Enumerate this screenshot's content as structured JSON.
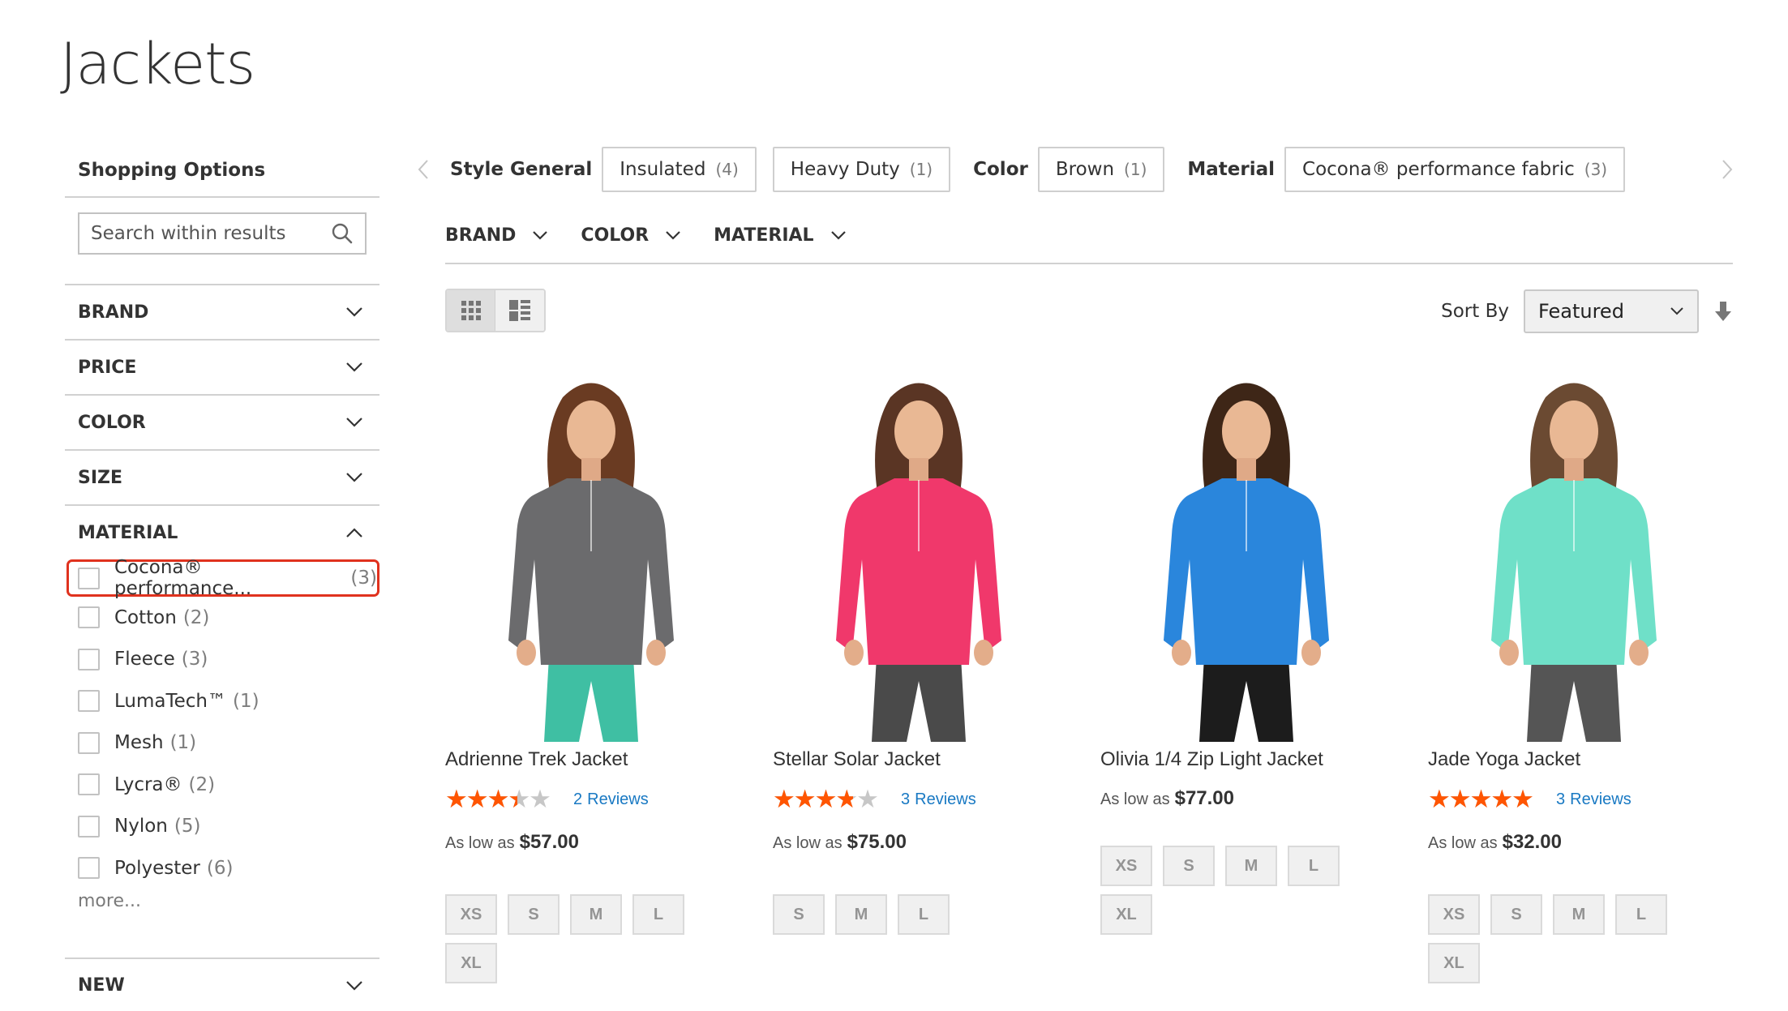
{
  "page": {
    "title": "Jackets"
  },
  "sidebar": {
    "title": "Shopping Options",
    "search_placeholder": "Search within results",
    "filters": [
      {
        "label": "BRAND",
        "expanded": false
      },
      {
        "label": "PRICE",
        "expanded": false
      },
      {
        "label": "COLOR",
        "expanded": false
      },
      {
        "label": "SIZE",
        "expanded": false
      },
      {
        "label": "MATERIAL",
        "expanded": true
      }
    ],
    "material_options": [
      {
        "label": "Cocona® performance...",
        "count": "(3)",
        "checked": false,
        "highlighted": true
      },
      {
        "label": "Cotton",
        "count": "(2)",
        "checked": false
      },
      {
        "label": "Fleece",
        "count": "(3)",
        "checked": false
      },
      {
        "label": "LumaTech™",
        "count": "(1)",
        "checked": false
      },
      {
        "label": "Mesh",
        "count": "(1)",
        "checked": false
      },
      {
        "label": "Lycra®",
        "count": "(2)",
        "checked": false
      },
      {
        "label": "Nylon",
        "count": "(5)",
        "checked": false
      },
      {
        "label": "Polyester",
        "count": "(6)",
        "checked": false
      }
    ],
    "more_label": "more...",
    "new_filter_label": "NEW"
  },
  "chips": {
    "groups": [
      {
        "label": "Style General",
        "items": [
          {
            "label": "Insulated",
            "count": "(4)"
          },
          {
            "label": "Heavy Duty",
            "count": "(1)"
          }
        ]
      },
      {
        "label": "Color",
        "items": [
          {
            "label": "Brown",
            "count": "(1)"
          }
        ]
      },
      {
        "label": "Material",
        "items": [
          {
            "label": "Cocona® performance fabric",
            "count": "(3)"
          }
        ]
      }
    ]
  },
  "hfilters": [
    {
      "label": "BRAND"
    },
    {
      "label": "COLOR"
    },
    {
      "label": "MATERIAL"
    }
  ],
  "toolbar": {
    "view_modes": [
      {
        "name": "grid",
        "active": true
      },
      {
        "name": "list",
        "active": false
      }
    ],
    "sort_label": "Sort By",
    "sort_value": "Featured",
    "sort_direction": "descending"
  },
  "products": [
    {
      "name": "Adrienne Trek Jacket",
      "rating_percent": 60,
      "reviews_count": "2",
      "reviews_label": "Reviews",
      "price_label": "As low as",
      "price": "$57.00",
      "sizes": [
        "XS",
        "S",
        "M",
        "L",
        "XL"
      ],
      "jacket_color": "#6b6b6d",
      "pants_color": "#3fbfa3",
      "hair_color": "#6a3b22"
    },
    {
      "name": "Stellar Solar Jacket",
      "rating_percent": 67,
      "reviews_count": "3",
      "reviews_label": "Reviews",
      "price_label": "As low as",
      "price": "$75.00",
      "sizes": [
        "S",
        "M",
        "L"
      ],
      "jacket_color": "#f0386b",
      "pants_color": "#4a4a4a",
      "hair_color": "#5a3524"
    },
    {
      "name": "Olivia 1/4 Zip Light Jacket",
      "rating_percent": null,
      "reviews_count": "",
      "reviews_label": "",
      "price_label": "As low as",
      "price": "$77.00",
      "sizes": [
        "XS",
        "S",
        "M",
        "L",
        "XL"
      ],
      "jacket_color": "#2a86dc",
      "pants_color": "#1c1c1c",
      "hair_color": "#3e2617"
    },
    {
      "name": "Jade Yoga Jacket",
      "rating_percent": 87,
      "reviews_count": "3",
      "reviews_label": "Reviews",
      "price_label": "As low as",
      "price": "$32.00",
      "sizes": [
        "XS",
        "S",
        "M",
        "L",
        "XL"
      ],
      "jacket_color": "#6fe0c8",
      "pants_color": "#555555",
      "hair_color": "#6b4a32"
    }
  ],
  "colors": {
    "star": "#ff5501",
    "star_empty": "#c7c7c7",
    "link": "#1979c3",
    "highlight_border": "#e0321e"
  }
}
